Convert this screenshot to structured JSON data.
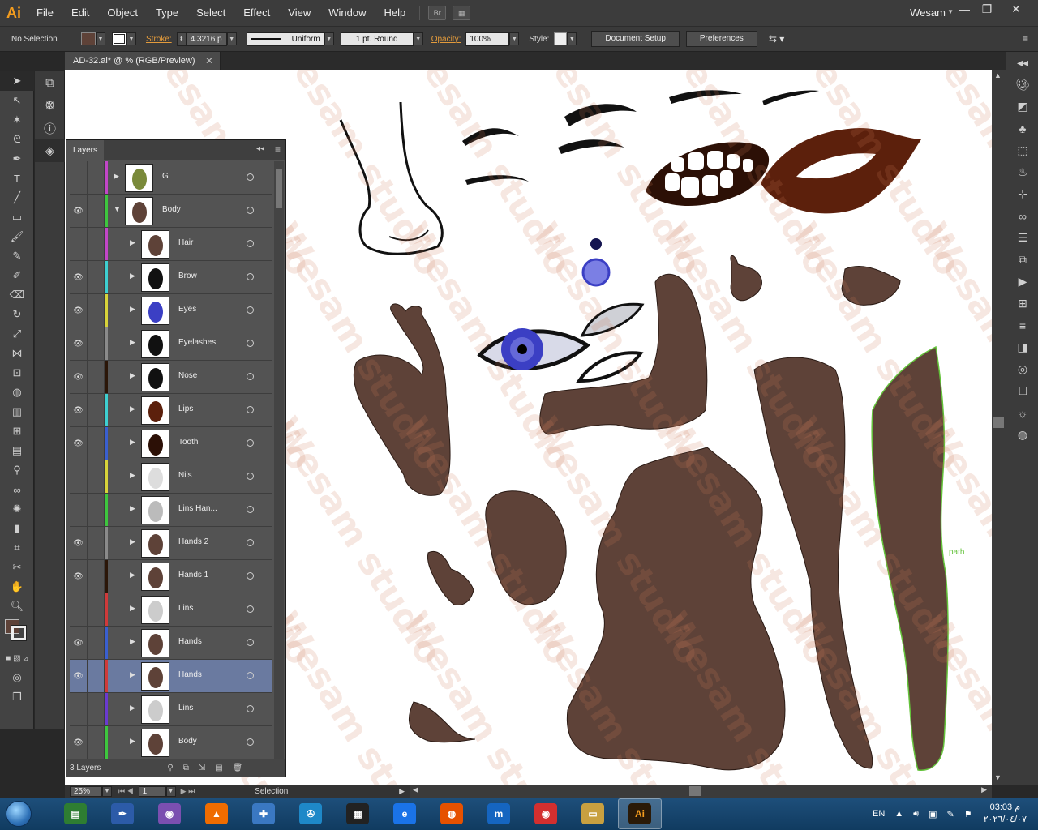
{
  "app": {
    "logo": "Ai",
    "menu": [
      "File",
      "Edit",
      "Object",
      "Type",
      "Select",
      "Effect",
      "View",
      "Window",
      "Help"
    ],
    "bridge_label": "Br",
    "user": "Wesam"
  },
  "controlbar": {
    "selection_status": "No Selection",
    "stroke_label": "Stroke:",
    "stroke_value": "4.3216 p",
    "profile_value": "Uniform",
    "brush_value": "1 pt. Round",
    "opacity_label": "Opacity:",
    "opacity_value": "100%",
    "style_label": "Style:",
    "document_setup": "Document Setup",
    "preferences": "Preferences"
  },
  "document": {
    "tab_title": "AD-32.ai* @ % (RGB/Preview)",
    "watermark": "Wesam studio",
    "path_hint": "path"
  },
  "statusbar": {
    "zoom": "25%",
    "artboard": "1",
    "tool": "Selection"
  },
  "colors": {
    "skin": "#5e4238",
    "lips": "#5c200c",
    "mouth": "#2c1006",
    "eye_iris": "#3b3fc4",
    "accent_orange": "#e39b3c",
    "selection_green": "#63c23a"
  },
  "layers": {
    "title": "Layers",
    "count": "3 Layers",
    "rows": [
      {
        "name": "G",
        "visible": false,
        "color": "#c246c7",
        "indent": 0,
        "expanded": false
      },
      {
        "name": "Body",
        "visible": true,
        "color": "#3ec63e",
        "indent": 0,
        "expanded": true
      },
      {
        "name": "Hair",
        "visible": false,
        "color": "#c246c7",
        "indent": 1,
        "expanded": false
      },
      {
        "name": "Brow",
        "visible": true,
        "color": "#3ecfd0",
        "indent": 1,
        "expanded": false
      },
      {
        "name": "Eyes",
        "visible": true,
        "color": "#d8d33a",
        "indent": 1,
        "expanded": false
      },
      {
        "name": "Eyelashes",
        "visible": true,
        "color": "#8a8a8a",
        "indent": 1,
        "expanded": false
      },
      {
        "name": "Nose",
        "visible": true,
        "color": "#2b1608",
        "indent": 1,
        "expanded": false
      },
      {
        "name": "Lips",
        "visible": true,
        "color": "#3ecfd0",
        "indent": 1,
        "expanded": false
      },
      {
        "name": "Tooth",
        "visible": true,
        "color": "#3a5fcf",
        "indent": 1,
        "expanded": false
      },
      {
        "name": "Nils",
        "visible": false,
        "color": "#d8d33a",
        "indent": 1,
        "expanded": false
      },
      {
        "name": "Lins Han...",
        "visible": false,
        "color": "#3ec63e",
        "indent": 1,
        "expanded": false
      },
      {
        "name": "Hands 2",
        "visible": true,
        "color": "#8a8a8a",
        "indent": 1,
        "expanded": false
      },
      {
        "name": "Hands 1",
        "visible": true,
        "color": "#2b1608",
        "indent": 1,
        "expanded": false
      },
      {
        "name": "Lins",
        "visible": false,
        "color": "#cf3a3a",
        "indent": 1,
        "expanded": false
      },
      {
        "name": "Hands",
        "visible": true,
        "color": "#3a5fcf",
        "indent": 1,
        "expanded": false
      },
      {
        "name": "Hands",
        "visible": true,
        "color": "#cf3a3a",
        "indent": 1,
        "expanded": false,
        "selected": true
      },
      {
        "name": "Lins",
        "visible": false,
        "color": "#6a3acf",
        "indent": 1,
        "expanded": false
      },
      {
        "name": "Body",
        "visible": true,
        "color": "#3ec63e",
        "indent": 1,
        "expanded": false
      }
    ]
  },
  "taskbar": {
    "apps": [
      "Task Manager",
      "Inkscape",
      "Eye app",
      "VLC",
      "Scanner",
      "Media app",
      "Video Studio",
      "Edge",
      "Firefox",
      "Maxthon",
      "Chrome",
      "Explorer",
      "Illustrator"
    ],
    "active_app": "Illustrator",
    "language": "EN",
    "time": "03:03 م",
    "date": "٢٠٢٦/٠٤/٠٧"
  }
}
